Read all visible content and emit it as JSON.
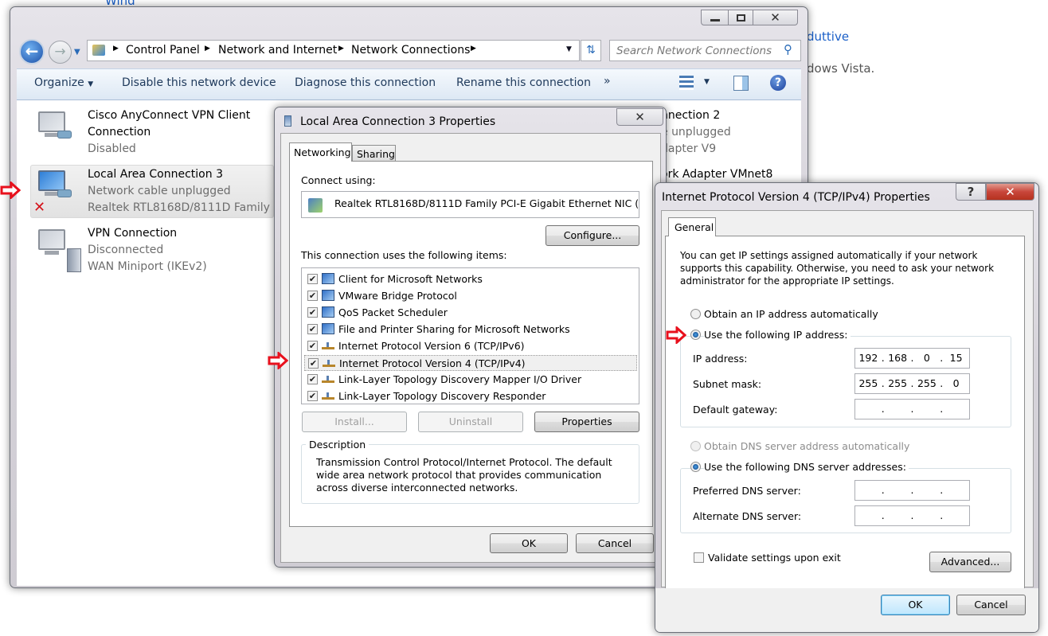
{
  "background": {
    "top_text": "Wind",
    "right_link": "duttive",
    "right_text": "dows Vista."
  },
  "explorer": {
    "breadcrumb": [
      "Control Panel",
      "Network and Internet",
      "Network Connections"
    ],
    "search_placeholder": "Search Network Connections",
    "toolbar": {
      "organize": "Organize",
      "disable": "Disable this network device",
      "diagnose": "Diagnose this connection",
      "rename": "Rename this connection",
      "more": "»"
    },
    "connections": [
      {
        "name": "Cisco AnyConnect VPN Client",
        "name2": "Connection",
        "status": "Disabled",
        "device": ""
      },
      {
        "name": "Local Area Connection 3",
        "status": "Network cable unplugged",
        "device": "Realtek RTL8168D/8111D Family ..."
      },
      {
        "name": "VPN Connection",
        "status": "Disconnected",
        "device": "WAN Miniport (IKEv2)"
      }
    ],
    "partial_connections": [
      {
        "name": "nnection 2",
        "status": "e unplugged",
        "device": "dapter V9"
      },
      {
        "name": "ork Adapter VMnet8"
      }
    ]
  },
  "properties_dialog": {
    "title": "Local Area Connection 3 Properties",
    "tabs": [
      "Networking",
      "Sharing"
    ],
    "connect_using_label": "Connect using:",
    "adapter": "Realtek RTL8168D/8111D Family PCI-E Gigabit Ethernet NIC (",
    "configure": "Configure...",
    "items_label": "This connection uses the following items:",
    "items": [
      {
        "label": "Client for Microsoft Networks",
        "checked": true
      },
      {
        "label": "VMware Bridge Protocol",
        "checked": true
      },
      {
        "label": "QoS Packet Scheduler",
        "checked": true
      },
      {
        "label": "File and Printer Sharing for Microsoft Networks",
        "checked": true
      },
      {
        "label": "Internet Protocol Version 6 (TCP/IPv6)",
        "checked": true
      },
      {
        "label": "Internet Protocol Version 4 (TCP/IPv4)",
        "checked": true
      },
      {
        "label": "Link-Layer Topology Discovery Mapper I/O Driver",
        "checked": true
      },
      {
        "label": "Link-Layer Topology Discovery Responder",
        "checked": true
      }
    ],
    "install": "Install...",
    "uninstall": "Uninstall",
    "properties": "Properties",
    "description_label": "Description",
    "description": "Transmission Control Protocol/Internet Protocol. The default wide area network protocol that provides communication across diverse interconnected networks.",
    "ok": "OK",
    "cancel": "Cancel"
  },
  "ipv4_dialog": {
    "title": "Internet Protocol Version 4 (TCP/IPv4) Properties",
    "tab": "General",
    "intro": "You can get IP settings assigned automatically if your network supports this capability. Otherwise, you need to ask your network administrator for the appropriate IP settings.",
    "obtain_ip": "Obtain an IP address automatically",
    "use_ip": "Use the following IP address:",
    "ip_label": "IP address:",
    "ip": [
      "192",
      "168",
      "0",
      "15"
    ],
    "mask_label": "Subnet mask:",
    "mask": [
      "255",
      "255",
      "255",
      "0"
    ],
    "gateway_label": "Default gateway:",
    "obtain_dns": "Obtain DNS server address automatically",
    "use_dns": "Use the following DNS server addresses:",
    "preferred_dns_label": "Preferred DNS server:",
    "alternate_dns_label": "Alternate DNS server:",
    "validate": "Validate settings upon exit",
    "validate_checked": false,
    "advanced": "Advanced...",
    "ok": "OK",
    "cancel": "Cancel",
    "selected_ip_mode": "manual",
    "selected_dns_mode": "manual"
  },
  "colors": {
    "annotation_arrow": "#e8101c",
    "link": "#1a5fc8",
    "close_red": "#c8463a"
  }
}
